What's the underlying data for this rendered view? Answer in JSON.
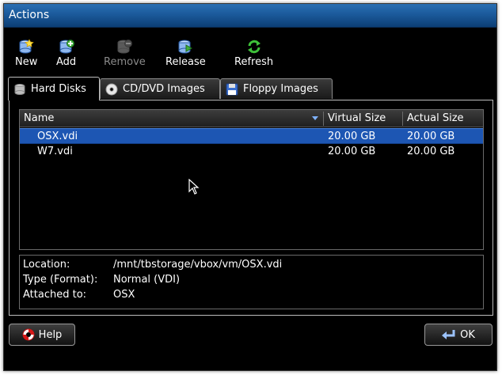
{
  "window": {
    "title": "Actions"
  },
  "toolbar": {
    "new_label": "New",
    "add_label": "Add",
    "remove_label": "Remove",
    "release_label": "Release",
    "refresh_label": "Refresh"
  },
  "tabs": [
    {
      "label": "Hard Disks",
      "icon": "hard-disk-icon",
      "active": true
    },
    {
      "label": "CD/DVD Images",
      "icon": "cd-icon",
      "active": false
    },
    {
      "label": "Floppy Images",
      "icon": "floppy-icon",
      "active": false
    }
  ],
  "table": {
    "columns": [
      "Name",
      "Virtual Size",
      "Actual Size"
    ],
    "rows": [
      {
        "name": "OSX.vdi",
        "virtual_size": "20.00 GB",
        "actual_size": "20.00 GB",
        "selected": true
      },
      {
        "name": "W7.vdi",
        "virtual_size": "20.00 GB",
        "actual_size": "20.00 GB",
        "selected": false
      }
    ]
  },
  "details": {
    "location_label": "Location:",
    "location_value": "/mnt/tbstorage/vbox/vm/OSX.vdi",
    "type_label": "Type (Format):",
    "type_value": "Normal (VDI)",
    "attached_label": "Attached to:",
    "attached_value": "OSX"
  },
  "buttons": {
    "help_label": "Help",
    "ok_label": "OK"
  },
  "colors": {
    "selection": "#1d56b3",
    "titlebar": "#1b5a9b",
    "background": "#000000"
  }
}
